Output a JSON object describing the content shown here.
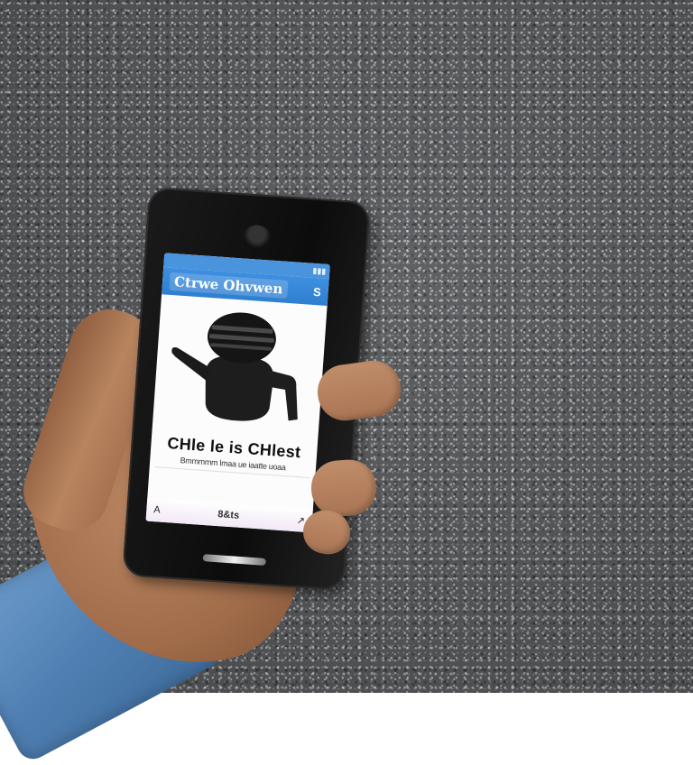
{
  "screen": {
    "status_text": "",
    "app_title": "Ctrwe Ohvwen",
    "header_icon": "S",
    "headline": "CHle le is CHlest",
    "subline": "Bmmmmm lmaa ue iaatte uoaa",
    "small_line": "",
    "bottom_left": "A",
    "bottom_label": "8&ts",
    "bottom_right": "↗"
  },
  "icons": {
    "earpiece": "camera-notch-icon",
    "mascot": "mascot-figure-icon",
    "share": "share-icon",
    "back": "back-arrow-icon"
  },
  "colors": {
    "header_blue": "#2f7fd0",
    "asphalt": "#55575a",
    "sleeve": "#5a8bbe",
    "skin": "#b07a56",
    "phone": "#111111"
  }
}
